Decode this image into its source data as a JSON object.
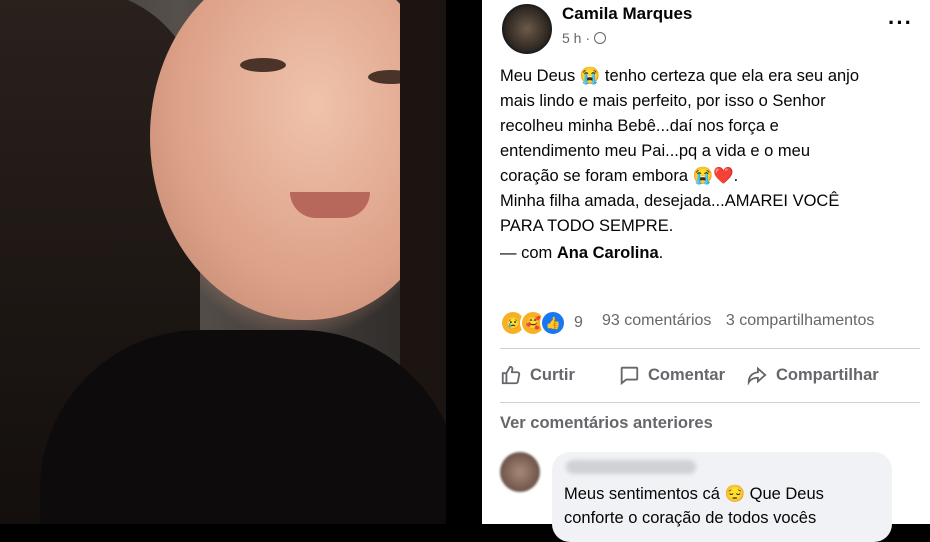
{
  "post": {
    "author": "Camila Marques",
    "time": "5 h",
    "separator": "·",
    "more": "···",
    "body_lines": [
      "Meu Deus 😭 tenho certeza que ela era seu anjo",
      "mais lindo e mais perfeito, por isso o Senhor",
      "recolheu minha Bebê...daí nos força e",
      "entendimento meu Pai...pq a vida e o meu",
      "coração se foram embora 😭❤️.",
      "Minha filha amada, desejada...AMAREI VOCÊ",
      "PARA TODO SEMPRE."
    ],
    "with_prefix": "— com ",
    "with_name": "Ana Carolina",
    "with_suffix": ".",
    "reaction_count": "9",
    "comments": "93 comentários",
    "shares": "3 compartilhamentos",
    "actions": {
      "like": "Curtir",
      "comment": "Comentar",
      "share": "Compartilhar"
    },
    "previous_comments": "Ver comentários anteriores",
    "comment_lines": [
      "Meus sentimentos cá 😔 Que Deus",
      "conforte o coração de todos vocês"
    ]
  },
  "reaction_icons": [
    "sad-icon",
    "care-icon",
    "like-icon"
  ],
  "colors": {
    "like_blue": "#1877f2",
    "muted_text": "#65676b",
    "bubble_bg": "#f0f2f5"
  }
}
